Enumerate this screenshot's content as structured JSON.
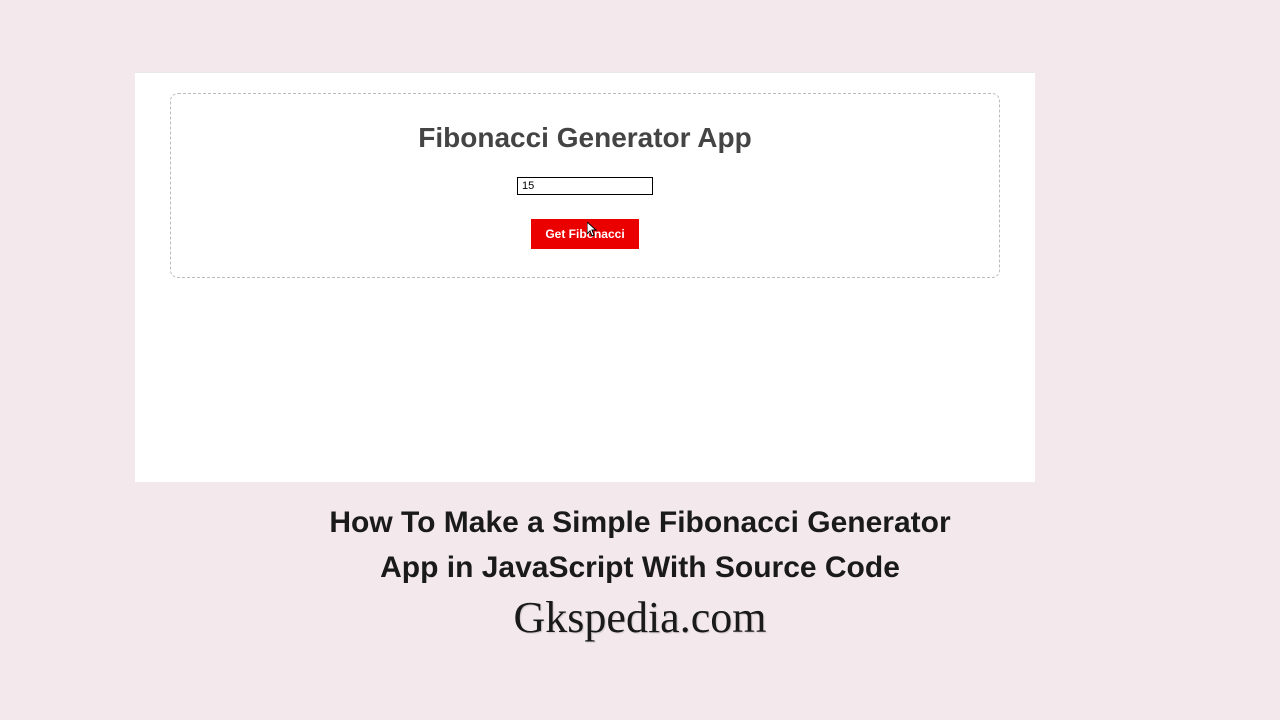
{
  "app": {
    "title": "Fibonacci Generator App",
    "input_value": "15",
    "button_label": "Get Fibonacci"
  },
  "article": {
    "title": "How To Make a Simple Fibonacci Generator App in JavaScript With Source Code",
    "site_name": "Gkspedia.com"
  }
}
